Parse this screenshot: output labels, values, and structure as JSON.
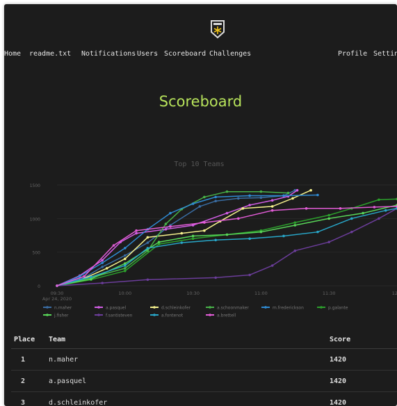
{
  "nav": {
    "items": [
      {
        "label": "Home"
      },
      {
        "label": "readme.txt"
      },
      {
        "label": "Notifications"
      },
      {
        "label": "Users"
      },
      {
        "label": "Scoreboard"
      },
      {
        "label": "Challenges"
      }
    ],
    "right_items": [
      {
        "label": "Profile"
      },
      {
        "label": "Settings"
      }
    ]
  },
  "page": {
    "title": "Scoreboard"
  },
  "colors": {
    "accent": "#b7e35b",
    "background": "#1c1c1c"
  },
  "chart_data": {
    "type": "line",
    "title": "Top 10 Teams",
    "xlabel": "",
    "ylabel": "",
    "x_ticks": [
      "09:30\nApr 24, 2020",
      "10:00",
      "10:30",
      "11:00",
      "11:30",
      "12:0"
    ],
    "y_ticks": [
      0,
      500,
      1000,
      1500
    ],
    "ylim": [
      0,
      1500
    ],
    "legend_position": "bottom-left",
    "series": [
      {
        "name": "n.maher",
        "color": "#3a6ea5",
        "points": [
          [
            "09:30",
            0
          ],
          [
            "09:42",
            120
          ],
          [
            "09:50",
            280
          ],
          [
            "10:00",
            450
          ],
          [
            "10:10",
            640
          ],
          [
            "10:20",
            900
          ],
          [
            "10:33",
            1180
          ],
          [
            "10:40",
            1260
          ],
          [
            "10:50",
            1300
          ],
          [
            "11:00",
            1310
          ],
          [
            "11:10",
            1340
          ],
          [
            "11:15",
            1420
          ]
        ]
      },
      {
        "name": "a.pasquel",
        "color": "#d35ee6",
        "points": [
          [
            "09:30",
            0
          ],
          [
            "09:40",
            150
          ],
          [
            "09:50",
            380
          ],
          [
            "09:58",
            650
          ],
          [
            "10:05",
            780
          ],
          [
            "10:18",
            840
          ],
          [
            "10:30",
            900
          ],
          [
            "10:45",
            1080
          ],
          [
            "10:55",
            1200
          ],
          [
            "11:05",
            1270
          ],
          [
            "11:12",
            1330
          ],
          [
            "11:16",
            1420
          ]
        ]
      },
      {
        "name": "d.schleinkofer",
        "color": "#f6f28d",
        "points": [
          [
            "09:30",
            0
          ],
          [
            "09:40",
            80
          ],
          [
            "09:52",
            260
          ],
          [
            "10:00",
            400
          ],
          [
            "10:10",
            720
          ],
          [
            "10:25",
            780
          ],
          [
            "10:35",
            820
          ],
          [
            "10:42",
            960
          ],
          [
            "10:52",
            1150
          ],
          [
            "11:05",
            1180
          ],
          [
            "11:14",
            1300
          ],
          [
            "11:22",
            1420
          ]
        ]
      },
      {
        "name": "a.schoonmaker",
        "color": "#48b249",
        "points": [
          [
            "09:30",
            0
          ],
          [
            "09:45",
            120
          ],
          [
            "10:00",
            260
          ],
          [
            "10:10",
            520
          ],
          [
            "10:18",
            920
          ],
          [
            "10:25",
            1140
          ],
          [
            "10:35",
            1320
          ],
          [
            "10:45",
            1400
          ],
          [
            "11:00",
            1400
          ],
          [
            "11:12",
            1380
          ]
        ]
      },
      {
        "name": "m.frederickson",
        "color": "#2f8bd4",
        "points": [
          [
            "09:30",
            0
          ],
          [
            "09:40",
            140
          ],
          [
            "09:50",
            340
          ],
          [
            "10:00",
            560
          ],
          [
            "10:10",
            840
          ],
          [
            "10:20",
            1080
          ],
          [
            "10:30",
            1220
          ],
          [
            "10:40",
            1320
          ],
          [
            "10:55",
            1340
          ],
          [
            "11:10",
            1340
          ],
          [
            "11:25",
            1350
          ]
        ]
      },
      {
        "name": "p.galante",
        "color": "#2ca02c",
        "points": [
          [
            "09:30",
            0
          ],
          [
            "09:45",
            90
          ],
          [
            "10:00",
            220
          ],
          [
            "10:15",
            620
          ],
          [
            "10:30",
            700
          ],
          [
            "10:45",
            760
          ],
          [
            "11:00",
            820
          ],
          [
            "11:15",
            940
          ],
          [
            "11:30",
            1050
          ],
          [
            "11:40",
            1150
          ],
          [
            "11:52",
            1280
          ],
          [
            "12:00",
            1290
          ]
        ]
      },
      {
        "name": "j.fisher",
        "color": "#58d658",
        "points": [
          [
            "09:30",
            0
          ],
          [
            "09:45",
            100
          ],
          [
            "10:00",
            330
          ],
          [
            "10:15",
            650
          ],
          [
            "10:30",
            740
          ],
          [
            "10:45",
            760
          ],
          [
            "11:00",
            800
          ],
          [
            "11:15",
            900
          ],
          [
            "11:30",
            1000
          ],
          [
            "11:45",
            1080
          ],
          [
            "12:00",
            1200
          ]
        ]
      },
      {
        "name": "f.santisteven",
        "color": "#6b3d9a",
        "points": [
          [
            "09:30",
            0
          ],
          [
            "09:50",
            40
          ],
          [
            "10:10",
            90
          ],
          [
            "10:40",
            120
          ],
          [
            "10:55",
            160
          ],
          [
            "11:05",
            300
          ],
          [
            "11:15",
            520
          ],
          [
            "11:30",
            650
          ],
          [
            "11:40",
            800
          ],
          [
            "11:52",
            1000
          ],
          [
            "12:00",
            1150
          ]
        ]
      },
      {
        "name": "a.fontenot",
        "color": "#28a7c9",
        "points": [
          [
            "09:30",
            0
          ],
          [
            "09:45",
            130
          ],
          [
            "10:00",
            300
          ],
          [
            "10:10",
            560
          ],
          [
            "10:25",
            640
          ],
          [
            "10:40",
            680
          ],
          [
            "10:55",
            700
          ],
          [
            "11:10",
            740
          ],
          [
            "11:25",
            800
          ],
          [
            "11:40",
            1000
          ],
          [
            "11:55",
            1120
          ],
          [
            "12:00",
            1150
          ]
        ]
      },
      {
        "name": "a.brettell",
        "color": "#e25cd6",
        "points": [
          [
            "09:30",
            0
          ],
          [
            "09:42",
            140
          ],
          [
            "09:55",
            600
          ],
          [
            "10:05",
            820
          ],
          [
            "10:20",
            880
          ],
          [
            "10:35",
            940
          ],
          [
            "10:50",
            1000
          ],
          [
            "11:05",
            1120
          ],
          [
            "11:20",
            1150
          ],
          [
            "11:35",
            1150
          ],
          [
            "11:50",
            1170
          ],
          [
            "12:00",
            1180
          ]
        ]
      }
    ]
  },
  "table": {
    "headers": {
      "place": "Place",
      "team": "Team",
      "score": "Score"
    },
    "rows": [
      {
        "place": "1",
        "team": "n.maher",
        "score": "1420"
      },
      {
        "place": "2",
        "team": "a.pasquel",
        "score": "1420"
      },
      {
        "place": "3",
        "team": "d.schleinkofer",
        "score": "1420"
      }
    ]
  }
}
